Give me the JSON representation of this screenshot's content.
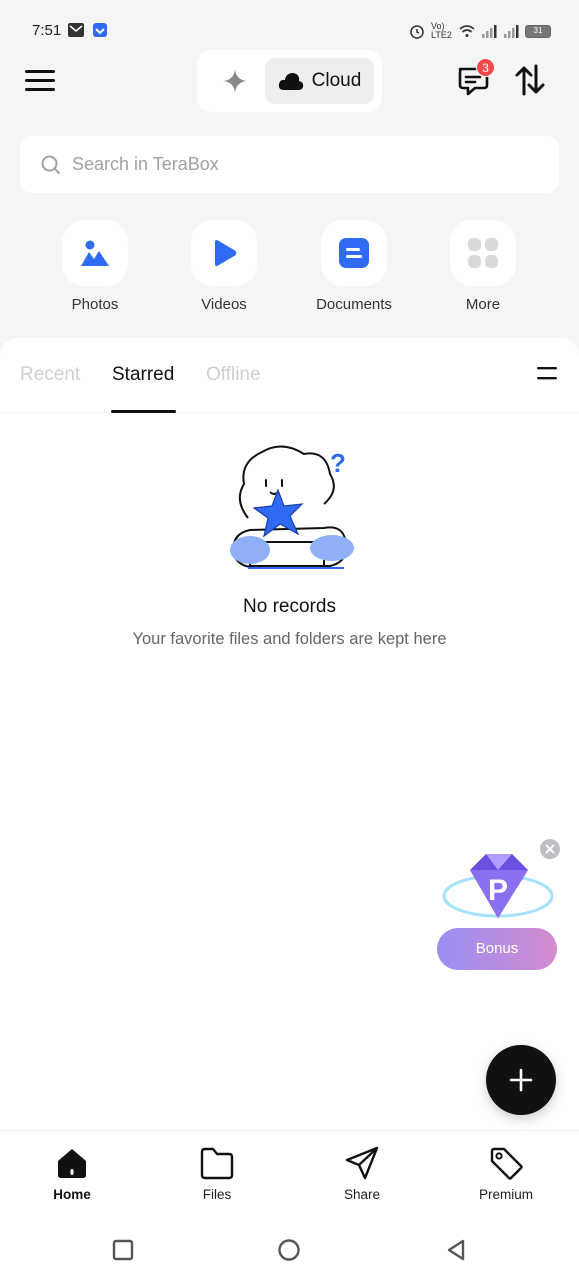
{
  "status": {
    "time": "7:51",
    "network_label": "Vo) LTE2",
    "battery": "31"
  },
  "top": {
    "mode_cloud_label": "Cloud",
    "message_badge": "3"
  },
  "search": {
    "placeholder": "Search in TeraBox"
  },
  "quick": [
    {
      "label": "Photos",
      "icon": "photos-icon"
    },
    {
      "label": "Videos",
      "icon": "videos-icon"
    },
    {
      "label": "Documents",
      "icon": "documents-icon"
    },
    {
      "label": "More",
      "icon": "more-grid-icon"
    }
  ],
  "tabs": [
    {
      "label": "Recent",
      "active": false
    },
    {
      "label": "Starred",
      "active": true
    },
    {
      "label": "Offline",
      "active": false
    }
  ],
  "empty": {
    "title": "No records",
    "subtitle": "Your favorite files and folders are kept here"
  },
  "bonus": {
    "label": "Bonus",
    "badge_letter": "P"
  },
  "nav": [
    {
      "label": "Home",
      "active": true
    },
    {
      "label": "Files",
      "active": false
    },
    {
      "label": "Share",
      "active": false
    },
    {
      "label": "Premium",
      "active": false
    }
  ],
  "colors": {
    "accent": "#2f6bf2",
    "background": "#f5f5f6",
    "badge": "#f04b4b",
    "fab": "#111111"
  }
}
